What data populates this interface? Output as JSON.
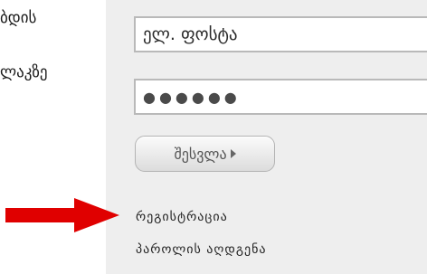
{
  "side": {
    "line1": "ბდის",
    "line2": "ლაკზე"
  },
  "form": {
    "username_value": "ელ. ფოსტა",
    "password_value": "●●●●●●",
    "login_label": "შესვლა"
  },
  "links": {
    "register": "რეგისტრაცია",
    "recover": "პაროლის აღდგენა"
  },
  "colors": {
    "panel_bg": "#eeeeee",
    "arrow": "#e00000"
  },
  "icons": {
    "login_arrow": "triangle-right-icon",
    "pointer": "red-arrow-icon"
  }
}
